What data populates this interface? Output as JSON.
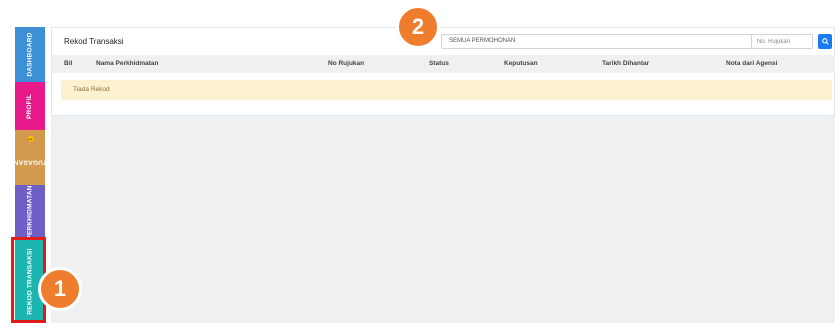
{
  "sidebar": {
    "tabs": [
      {
        "label": "DASHBOARD",
        "color": "#3d8fd6"
      },
      {
        "label": "PROFIL",
        "color": "#e8198b"
      },
      {
        "label": "TUGASAN",
        "color": "#d39a4e",
        "badge": "1"
      },
      {
        "label": "PERKHIDMATAN",
        "color": "#6e5fc6"
      },
      {
        "label": "REKOD TRANSAKSI",
        "color": "#1db5b0",
        "active": true
      }
    ]
  },
  "callouts": [
    "1",
    "2"
  ],
  "panel": {
    "title": "Rekod Transaksi",
    "filter_selected": "SEMUA PERMOHONAN",
    "reference_placeholder": "No. Rujukan",
    "search_icon": "search-icon"
  },
  "table": {
    "columns": [
      "Bil",
      "Nama Perkhidmatan",
      "No Rujukan",
      "Status",
      "Keputusan",
      "Tarikh Dihantar",
      "Nota dari Agensi"
    ],
    "empty_message": "Tiada Rekod"
  },
  "colors": {
    "accent": "#1a7cf0",
    "highlight": "#e01b1b",
    "callout": "#ef7d2d"
  }
}
